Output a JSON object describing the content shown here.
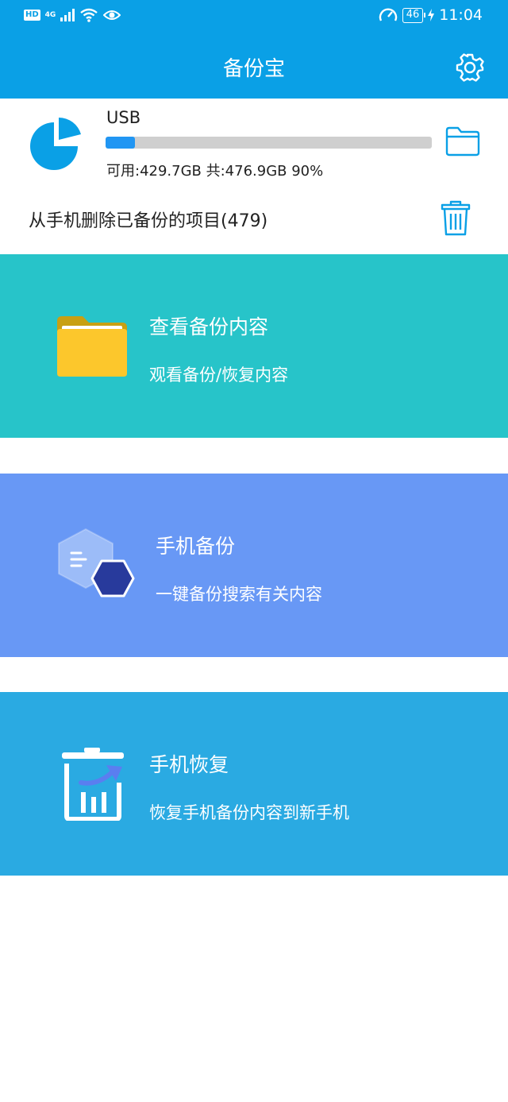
{
  "status_bar": {
    "hd": "HD",
    "network": "4G",
    "battery": "46",
    "time": "11:04"
  },
  "header": {
    "title": "备份宝"
  },
  "storage": {
    "device": "USB",
    "capacity_text": "可用:429.7GB 共:476.9GB  90%",
    "used_fraction": 0.09,
    "delete_text": "从手机删除已备份的项目(479)"
  },
  "cards": [
    {
      "title": "查看备份内容",
      "subtitle": "观看备份/恢复内容",
      "icon": "folder-icon",
      "color": "#27c4c9"
    },
    {
      "title": "手机备份",
      "subtitle": "一键备份搜索有关内容",
      "icon": "hexagon-backup-icon",
      "color": "#6898f5"
    },
    {
      "title": "手机恢复",
      "subtitle": "恢复手机备份内容到新手机",
      "icon": "restore-bin-icon",
      "color": "#2aaae2"
    }
  ],
  "colors": {
    "primary": "#0aa0e6",
    "progress": "#2196f3"
  }
}
